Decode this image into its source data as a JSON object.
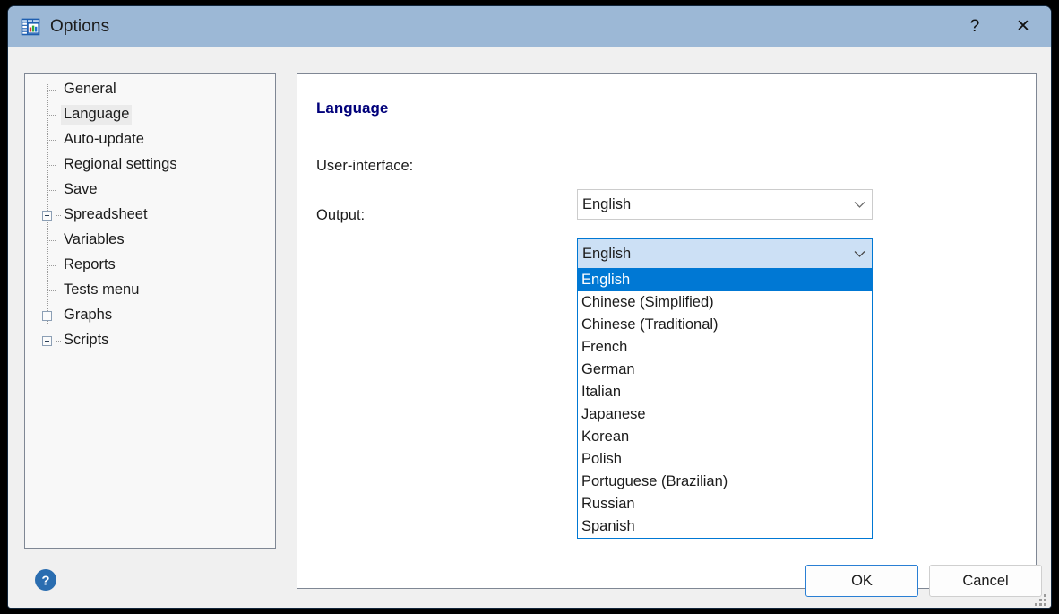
{
  "window": {
    "title": "Options",
    "icon": "spreadsheet-chart-icon",
    "help_caption": "?",
    "close_caption": "✕",
    "titlebar_color": "#9cb8d6",
    "accent_color": "#0078d4"
  },
  "sidebar": {
    "items": [
      {
        "label": "General",
        "expandable": false,
        "selected": false
      },
      {
        "label": "Language",
        "expandable": false,
        "selected": true
      },
      {
        "label": "Auto-update",
        "expandable": false,
        "selected": false
      },
      {
        "label": "Regional settings",
        "expandable": false,
        "selected": false
      },
      {
        "label": "Save",
        "expandable": false,
        "selected": false
      },
      {
        "label": "Spreadsheet",
        "expandable": true,
        "selected": false
      },
      {
        "label": "Variables",
        "expandable": false,
        "selected": false
      },
      {
        "label": "Reports",
        "expandable": false,
        "selected": false
      },
      {
        "label": "Tests menu",
        "expandable": false,
        "selected": false
      },
      {
        "label": "Graphs",
        "expandable": true,
        "selected": false
      },
      {
        "label": "Scripts",
        "expandable": true,
        "selected": false
      }
    ]
  },
  "content": {
    "section_title": "Language",
    "section_title_color": "#00007a",
    "fields": {
      "user_interface": {
        "label": "User-interface:",
        "value": "English",
        "state": "closed"
      },
      "output": {
        "label": "Output:",
        "value": "English",
        "state": "open"
      }
    },
    "dropdown": {
      "owner": "output",
      "highlighted": "English",
      "options": [
        "English",
        "Chinese (Simplified)",
        "Chinese (Traditional)",
        "French",
        "German",
        "Italian",
        "Japanese",
        "Korean",
        "Polish",
        "Portuguese (Brazilian)",
        "Russian",
        "Spanish"
      ]
    }
  },
  "footer": {
    "help_icon": "question-mark-circle-icon",
    "ok_label": "OK",
    "cancel_label": "Cancel"
  }
}
